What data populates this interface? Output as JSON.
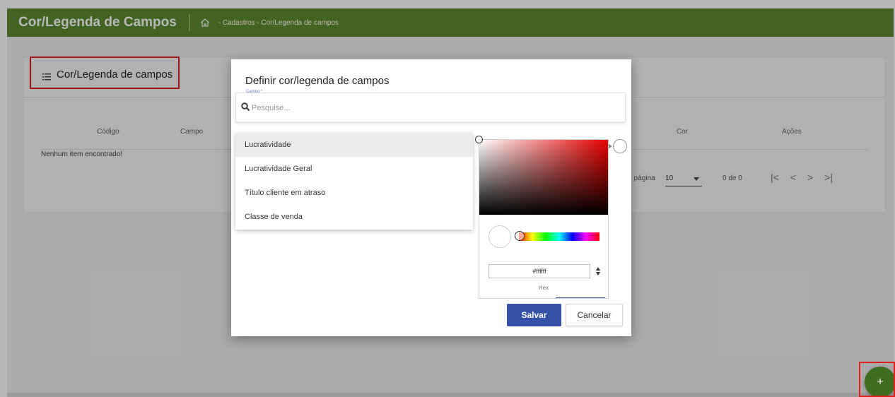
{
  "header": {
    "title": "Cor/Legenda de Campos",
    "breadcrumb": "- Cadastros - Cor/Legenda de campos",
    "home_icon": "home-icon"
  },
  "card": {
    "title": "Cor/Legenda de campos",
    "icon": "list-icon",
    "columns": [
      "Código",
      "Campo",
      "Cor",
      "Ações"
    ],
    "empty_text": "Nenhum item encontrado!",
    "pager": {
      "label": "or página",
      "size": "10",
      "count": "0 de 0",
      "buttons": [
        "|<",
        "<",
        ">",
        ">|"
      ]
    }
  },
  "modal": {
    "title": "Definir cor/legenda de campos",
    "field_label": "Campo *",
    "search_placeholder": "Pesquise...",
    "options": [
      "Lucratividade",
      "Lucratividade Geral",
      "Título cliente em atraso",
      "Classe de venda"
    ],
    "selected_option_index": 0,
    "color_picker": {
      "hue_color": "#e60000",
      "hex_value": "#ffffff",
      "hex_label": "Hex"
    },
    "save_label": "Salvar",
    "cancel_label": "Cancelar"
  },
  "fab": {
    "label": "+"
  },
  "colors": {
    "header_green": "#5c8a2e",
    "fab_green": "#3f6d1f",
    "primary_blue": "#3352a8",
    "highlight_red": "#e01e1e"
  }
}
